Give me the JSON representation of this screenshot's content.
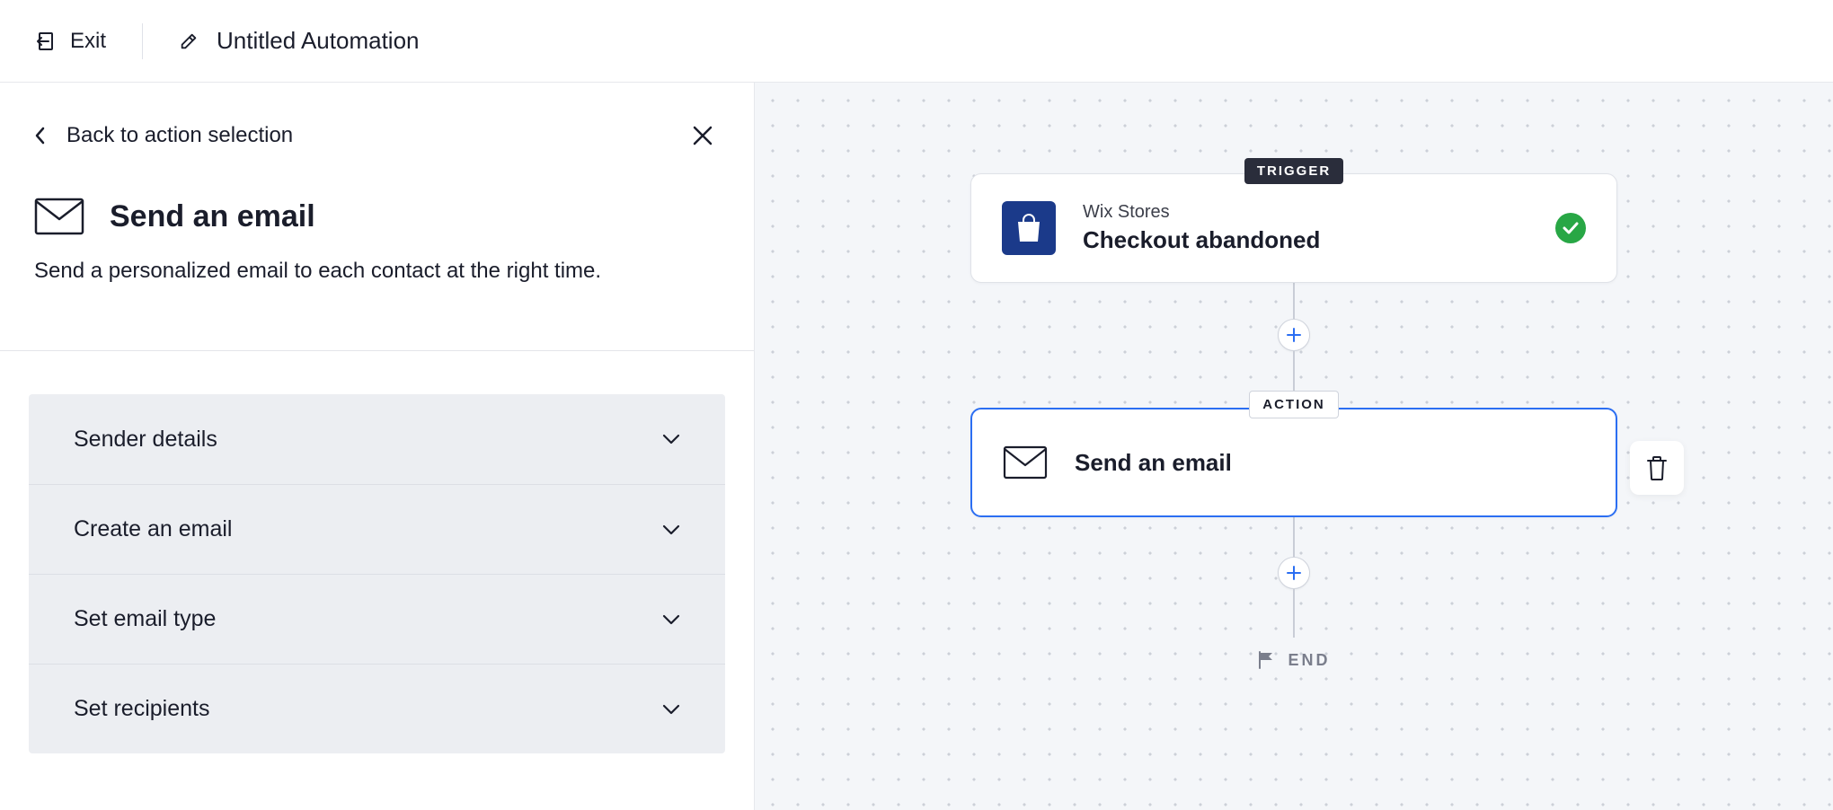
{
  "topbar": {
    "exit_label": "Exit",
    "automation_title": "Untitled Automation"
  },
  "panel": {
    "back_label": "Back to action selection",
    "title": "Send an email",
    "description": "Send a personalized email to each contact at the right time.",
    "accordion": {
      "item1": "Sender details",
      "item2": "Create an email",
      "item3": "Set email type",
      "item4": "Set recipients"
    }
  },
  "canvas": {
    "trigger_badge": "TRIGGER",
    "action_badge": "ACTION",
    "trigger": {
      "app": "Wix Stores",
      "event": "Checkout abandoned"
    },
    "action": {
      "title": "Send an email"
    },
    "end_label": "END"
  },
  "icons": {
    "exit": "exit-icon",
    "edit": "edit-icon",
    "back": "chevron-left-icon",
    "close": "close-icon",
    "envelope": "envelope-icon",
    "chevron_down": "chevron-down-icon",
    "bag": "shopping-bag-icon",
    "check": "check-circle-icon",
    "plus": "plus-icon",
    "trash": "trash-icon",
    "flag": "flag-icon"
  },
  "colors": {
    "accent": "#2b6ef2",
    "trigger_icon_bg": "#1b3a8a",
    "success": "#28a745",
    "badge_bg": "#2a2d3b"
  }
}
